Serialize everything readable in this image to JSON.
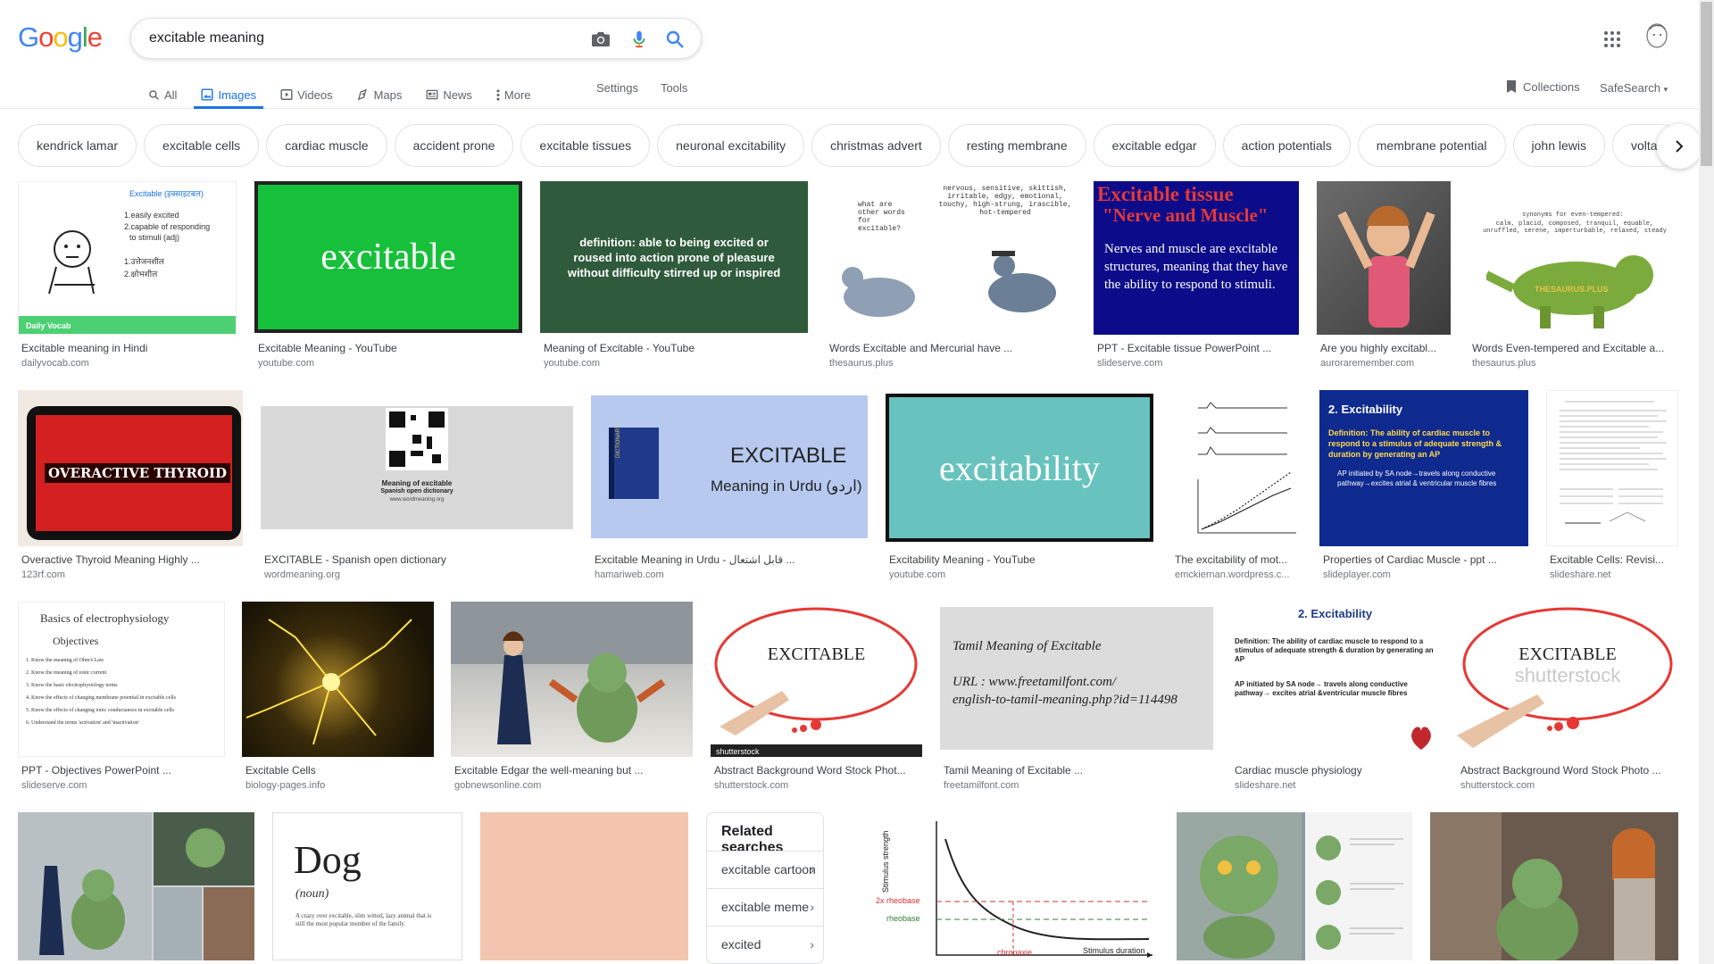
{
  "search": {
    "query": "excitable meaning"
  },
  "logo": "Google",
  "tabs": [
    {
      "label": "All"
    },
    {
      "label": "Images"
    },
    {
      "label": "Videos"
    },
    {
      "label": "Maps"
    },
    {
      "label": "News"
    },
    {
      "label": "More"
    }
  ],
  "settings_label": "Settings",
  "tools_label": "Tools",
  "collections_label": "Collections",
  "safesearch_label": "SafeSearch",
  "chips": [
    "kendrick lamar",
    "excitable cells",
    "cardiac muscle",
    "accident prone",
    "excitable tissues",
    "neuronal excitability",
    "christmas advert",
    "resting membrane",
    "excitable edgar",
    "action potentials",
    "membrane potential",
    "john lewis",
    "voltag"
  ],
  "results": [
    {
      "title": "Excitable meaning in Hindi",
      "source": "dailyvocab.com",
      "thumb_text": [
        "Excitable (इक्साइटबल)",
        "1.easily excited",
        "2.capable of responding",
        "to stimuli (adj)",
        "1.उत्तेजनशील",
        "2.क्षोभशील",
        "Daily Vocab"
      ]
    },
    {
      "title": "Excitable Meaning - YouTube",
      "source": "youtube.com",
      "thumb_text": [
        "excitable"
      ]
    },
    {
      "title": "Meaning of Excitable - YouTube",
      "source": "youtube.com",
      "thumb_text": [
        "definition: able to being excited or",
        "roused into action prone of pleasure",
        "without difficulty stirred up or inspired"
      ]
    },
    {
      "title": "Words Excitable and Mercurial have ...",
      "source": "thesaurus.plus",
      "thumb_text": [
        "what are other words for excitable?",
        "nervous, sensitive, skittish, irritable, edgy, emotional, touchy, high-strung, irascible, hot-tempered"
      ]
    },
    {
      "title": "PPT - Excitable tissue PowerPoint ...",
      "source": "slideserve.com",
      "thumb_text": [
        "Excitable tissue",
        "\"Nerve and Muscle\"",
        "Nerves and muscle are excitable structures, meaning that they have the ability to respond to stimuli."
      ]
    },
    {
      "title": "Are you highly excitabl...",
      "source": "auroraremember.com",
      "thumb_text": []
    },
    {
      "title": "Words Even-tempered and Excitable a...",
      "source": "thesaurus.plus",
      "thumb_text": [
        "synonyms for even-tempered:",
        "calm, placid, composed, tranquil, equable, unruffled, serene, imperturbable, relaxed, steady",
        "THESAURUS.PLUS"
      ]
    },
    {
      "title": "Overactive Thyroid Meaning Highly ...",
      "source": "123rf.com",
      "thumb_text": [
        "OVERACTIVE THYROID"
      ]
    },
    {
      "title": "EXCITABLE - Spanish open dictionary",
      "source": "wordmeaning.org",
      "thumb_text": [
        "Meaning of excitable",
        "Spanish open dictionary",
        "www.wordmeaning.org"
      ]
    },
    {
      "title": "Excitable Meaning in Urdu - قابل اشتعال ...",
      "source": "hamariweb.com",
      "thumb_text": [
        "EXCITABLE",
        "Meaning in Urdu (اردو)",
        "DICTIONARY"
      ]
    },
    {
      "title": "Excitability Meaning - YouTube",
      "source": "youtube.com",
      "thumb_text": [
        "excitability"
      ]
    },
    {
      "title": "The excitability of mot...",
      "source": "emckiernan.wordpress.c...",
      "thumb_text": []
    },
    {
      "title": "Properties of Cardiac Muscle - ppt ...",
      "source": "slideplayer.com",
      "thumb_text": [
        "2. Excitability",
        "Definition: The ability of cardiac muscle to respond to a stimulus of adequate strength & duration by generating an AP",
        "AP initiated by SA node→travels along conductive pathway→excites atrial & ventricular muscle fibres"
      ]
    },
    {
      "title": "Excitable Cells: Revisi...",
      "source": "slideshare.net",
      "thumb_text": []
    },
    {
      "title": "PPT - Objectives PowerPoint ...",
      "source": "slideserve.com",
      "thumb_text": [
        "Basics of electrophysiology",
        "Objectives",
        "1. Know the meaning of Ohm's Law",
        "2. Know the meaning of ionic current",
        "3. Know the basic electrophysiology terms",
        "4. Know the effects of changing membrane potential in excitable cells",
        "5. Know the effects of changing ionic conductances in excitable cells",
        "6. Understand the terms 'activation' and 'inactivation'"
      ]
    },
    {
      "title": "Excitable Cells",
      "source": "biology-pages.info",
      "thumb_text": []
    },
    {
      "title": "Excitable Edgar the well-meaning but ...",
      "source": "gobnewsonline.com",
      "thumb_text": []
    },
    {
      "title": "Abstract Background Word Stock Phot...",
      "source": "shutterstock.com",
      "thumb_text": [
        "EXCITABLE",
        "shutterstock"
      ]
    },
    {
      "title": "Tamil Meaning of Excitable ...",
      "source": "freetamilfont.com",
      "thumb_text": [
        "Tamil Meaning of Excitable",
        "URL : www.freetamilfont.com/",
        "english-to-tamil-meaning.php?id=114498"
      ]
    },
    {
      "title": "Cardiac muscle physiology",
      "source": "slideshare.net",
      "thumb_text": [
        "2. Excitability",
        "Definition: The ability of cardiac muscle to respond to a stimulus of adequate strength & duration by generating an AP",
        "AP initiated by SA node→ travels along conductive pathway→ excites atrial &ventricular muscle fibres"
      ]
    },
    {
      "title": "Abstract Background Word Stock Photo ...",
      "source": "shutterstock.com",
      "thumb_text": [
        "EXCITABLE",
        "shutterstock"
      ]
    },
    {
      "title": "",
      "source": "",
      "thumb_text": []
    },
    {
      "title": "",
      "source": "",
      "thumb_text": [
        "Dog",
        "(noun)",
        "A crazy over excitable, slim witted, lazy animal that is still the most popular member of the family."
      ]
    },
    {
      "title": "",
      "source": "",
      "thumb_text": []
    },
    {
      "title": "",
      "source": "",
      "thumb_text": [
        "Stimulus strength",
        "2x rheobase",
        "rheobase",
        "chronaxie",
        "Stimulus duration"
      ]
    },
    {
      "title": "",
      "source": "",
      "thumb_text": []
    },
    {
      "title": "",
      "source": "",
      "thumb_text": []
    }
  ],
  "related": {
    "title": "Related searches",
    "items": [
      "excitable cartoon",
      "excitable meme",
      "excited"
    ]
  }
}
